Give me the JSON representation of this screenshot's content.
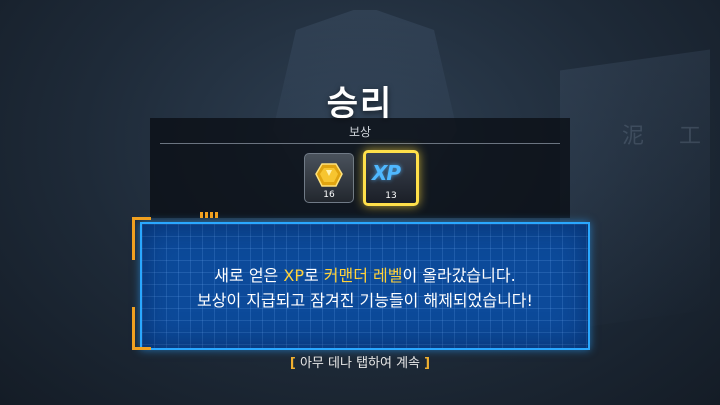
{
  "title": "승리",
  "rewards": {
    "label": "보상",
    "items": [
      {
        "icon": "gold-gem-icon",
        "count": "16"
      },
      {
        "icon": "xp-icon",
        "icon_text": "XP",
        "count": "13"
      }
    ]
  },
  "message": {
    "line1_a": "새로 얻은 ",
    "line1_xp": "XP",
    "line1_b": "로 ",
    "line1_level": "커맨더 레벨",
    "line1_c": "이 올라갔습니다.",
    "line2": "보상이 지급되고 잠겨진 기능들이 해제되었습니다!"
  },
  "continue": {
    "open": "[",
    "text": "아무 데나 탭하여 계속",
    "close": "]"
  },
  "background_glyphs": "泥 工",
  "colors": {
    "highlight": "#ffd23a",
    "panel_blue": "#0c4a9a",
    "frame_orange": "#f0a020",
    "xp_blue": "#4fb8ff"
  }
}
